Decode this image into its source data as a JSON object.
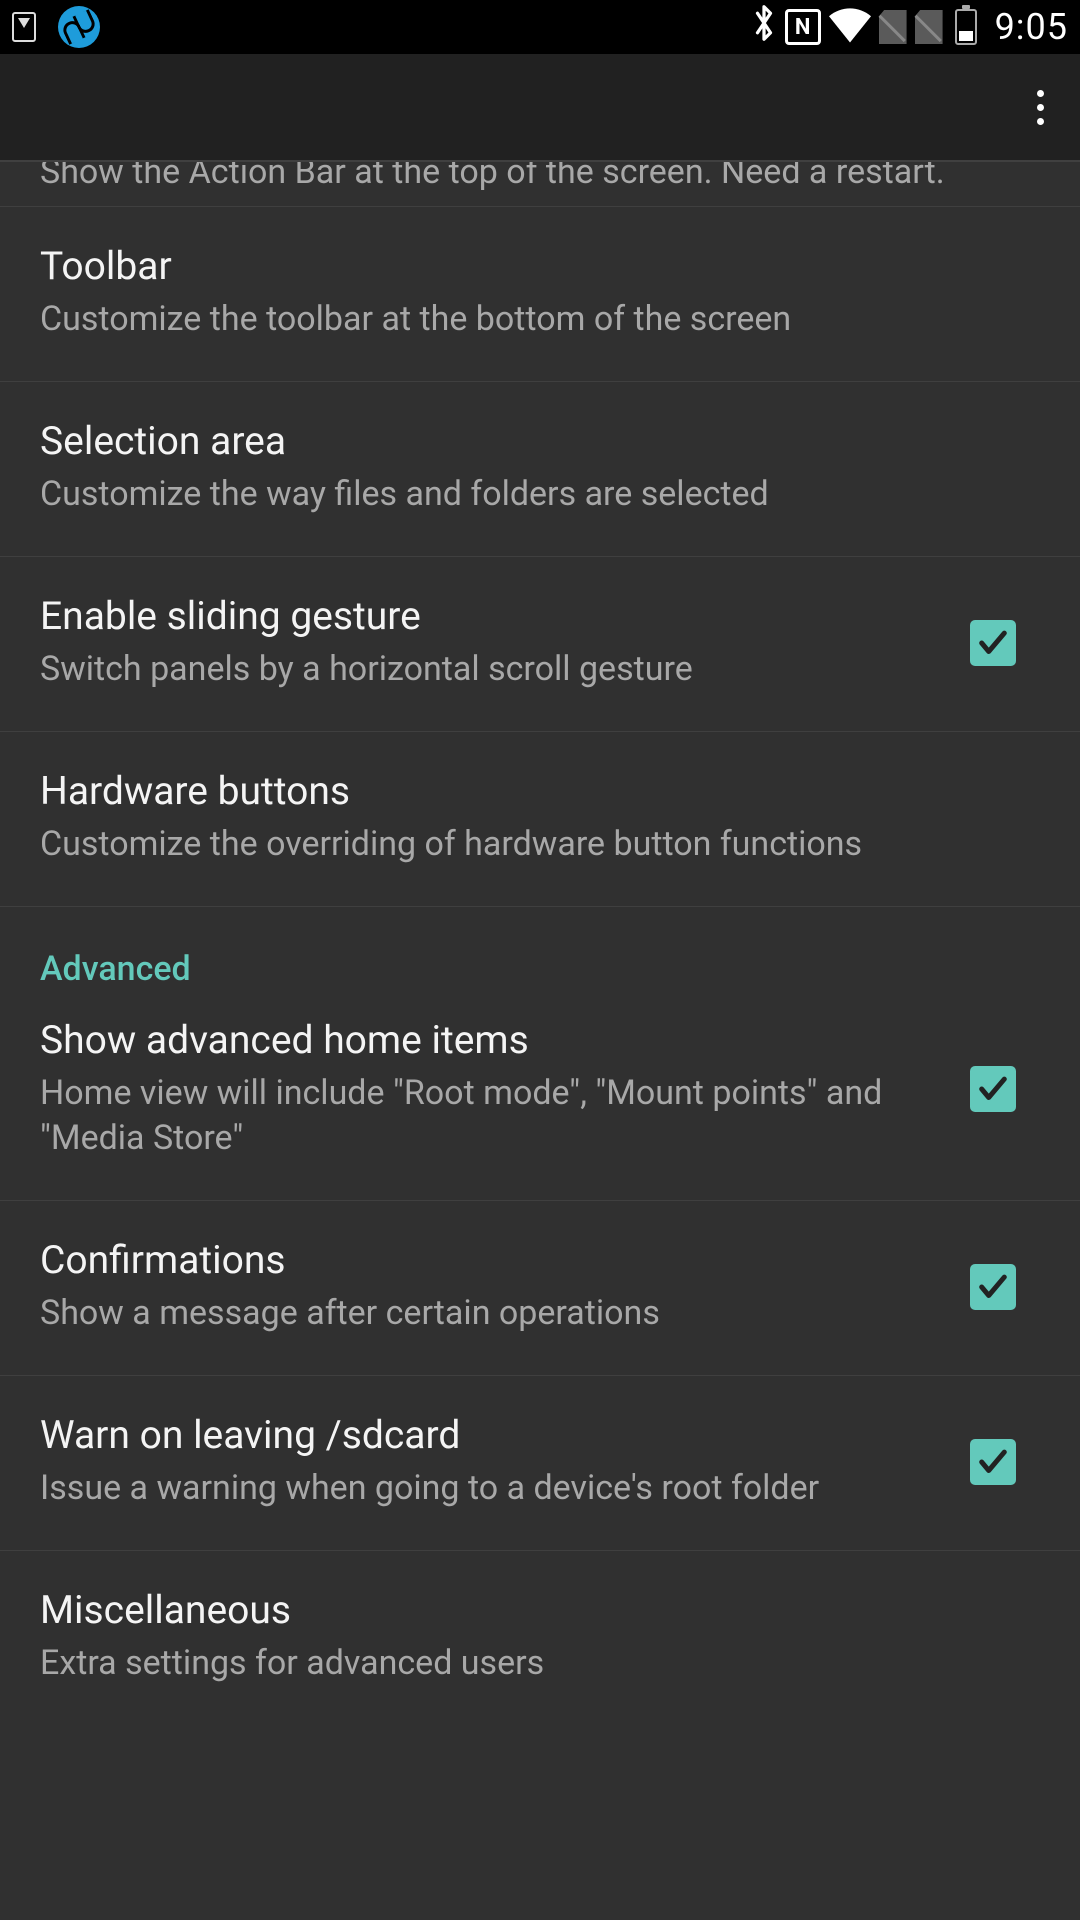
{
  "status_bar": {
    "time": "9:05",
    "nfc_label": "N"
  },
  "partial_item": {
    "text": "Show the Action Bar at the top of the screen. Need a restart."
  },
  "items": [
    {
      "title": "Toolbar",
      "subtitle": "Customize the toolbar at the bottom of the screen",
      "has_checkbox": false
    },
    {
      "title": "Selection area",
      "subtitle": "Customize the way files and folders are selected",
      "has_checkbox": false
    },
    {
      "title": "Enable sliding gesture",
      "subtitle": "Switch panels by a horizontal scroll gesture",
      "has_checkbox": true,
      "checked": true
    },
    {
      "title": "Hardware buttons",
      "subtitle": "Customize the overriding of hardware button functions",
      "has_checkbox": false
    }
  ],
  "section": {
    "header": "Advanced"
  },
  "advanced_items": [
    {
      "title": "Show advanced home items",
      "subtitle": "Home view will include \"Root mode\", \"Mount points\" and \"Media Store\"",
      "has_checkbox": true,
      "checked": true
    },
    {
      "title": "Confirmations",
      "subtitle": "Show a message after certain operations",
      "has_checkbox": true,
      "checked": true
    },
    {
      "title": "Warn on leaving /sdcard",
      "subtitle": "Issue a warning when going to a device's root folder",
      "has_checkbox": true,
      "checked": true
    },
    {
      "title": "Miscellaneous",
      "subtitle": "Extra settings for advanced users",
      "has_checkbox": false
    }
  ]
}
